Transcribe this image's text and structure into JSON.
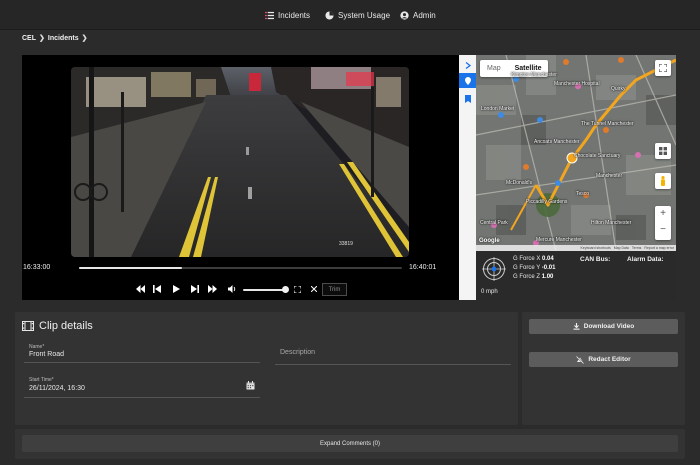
{
  "nav": {
    "items": [
      {
        "label": "Incidents",
        "icon": "list-icon"
      },
      {
        "label": "System Usage",
        "icon": "pie-chart-icon"
      },
      {
        "label": "Admin",
        "icon": "user-circle-icon"
      }
    ]
  },
  "breadcrumb": [
    "CEL",
    "Incidents"
  ],
  "video": {
    "time_start": "16:33:00",
    "time_end": "16:40:01",
    "progress": 0.32,
    "volume": 0.95,
    "trim_label": "Trim",
    "overlay_id": "33819"
  },
  "map": {
    "toggle_map": "Map",
    "toggle_satellite": "Satellite",
    "labels": {
      "manchester_hospital": "Manchester Hospital",
      "quirky": "Quirky",
      "kimpton": "Kimpton Manchester",
      "tunnel": "The Tunnel Manchester",
      "london_market": "London Market",
      "chocolate": "Chocolate Sanctuary",
      "ancoats": "Ancoats Manchester",
      "manchester": "Manchester",
      "mcdonalds": "McDonald's",
      "piccadilly": "Piccadilly Gardens",
      "tesco": "Tesco",
      "central": "Central Park",
      "hilton": "Hilton Manchester",
      "merc": "Mercure Manchester"
    },
    "footer": [
      "Keyboard shortcuts",
      "Map Data",
      "Terms",
      "Report a map error"
    ],
    "logo": "Google"
  },
  "telemetry": {
    "gforce_x_label": "G Force X",
    "gforce_x": "0.04",
    "gforce_y_label": "G Force Y",
    "gforce_y": "-0.01",
    "gforce_z_label": "G Force Z",
    "gforce_z": "1.00",
    "can_bus": "CAN Bus:",
    "alarm": "Alarm Data:",
    "speed": "0 mph"
  },
  "clip": {
    "title": "Clip details",
    "name_label": "Name*",
    "name_value": "Front Road",
    "start_label": "Start Time*",
    "start_value": "26/11/2024, 16:30",
    "description_label": "Description"
  },
  "actions": {
    "download": "Download Video",
    "redact": "Redact Editor"
  },
  "comments": {
    "expand": "Expand Comments (0)"
  },
  "colors": {
    "accent_blue": "#1a73e8",
    "route_orange": "#f2a51f"
  }
}
